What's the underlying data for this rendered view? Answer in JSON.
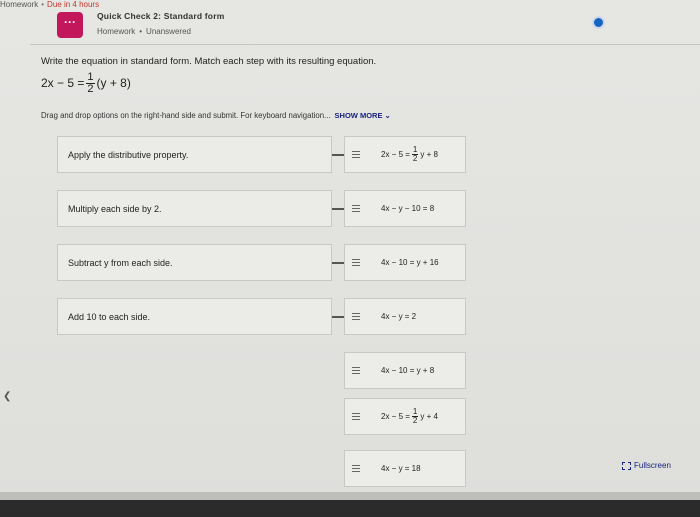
{
  "topbar": {
    "crumb": "Homework",
    "due": "Due in 4 hours"
  },
  "header": {
    "icon_glyph": "···",
    "title": "Quick Check 2: Standard form",
    "subtitle_course": "Homework",
    "subtitle_status": "Unanswered"
  },
  "question": {
    "prompt": "Write the equation in standard form. Match each step with its resulting equation.",
    "equation_left": "2x − 5 =",
    "equation_num": "1",
    "equation_den": "2",
    "equation_right": "(y + 8)",
    "instruction": "Drag and drop options on the right-hand side and submit. For keyboard navigation...",
    "show_more": "SHOW MORE ⌄"
  },
  "steps": [
    {
      "label": "Apply the distributive property."
    },
    {
      "label": "Multiply each side by 2."
    },
    {
      "label": "Subtract y from each side."
    },
    {
      "label": "Add 10 to each side."
    }
  ],
  "tiles": [
    {
      "pre": "2x − 5 =",
      "num": "1",
      "den": "2",
      "post": "y + 8"
    },
    {
      "text": "4x − y − 10 = 8"
    },
    {
      "text": "4x − 10 = y + 16"
    },
    {
      "text": "4x − y = 2"
    },
    {
      "text": "4x − 10 = y + 8"
    },
    {
      "pre": "2x − 5 =",
      "num": "1",
      "den": "2",
      "post": "y + 4"
    },
    {
      "text": "4x − y = 18"
    }
  ],
  "fullscreen_label": "Fullscreen",
  "colors": {
    "accent": "#1565c0",
    "assignment_icon": "#c2185b",
    "link": "#1a237e"
  }
}
